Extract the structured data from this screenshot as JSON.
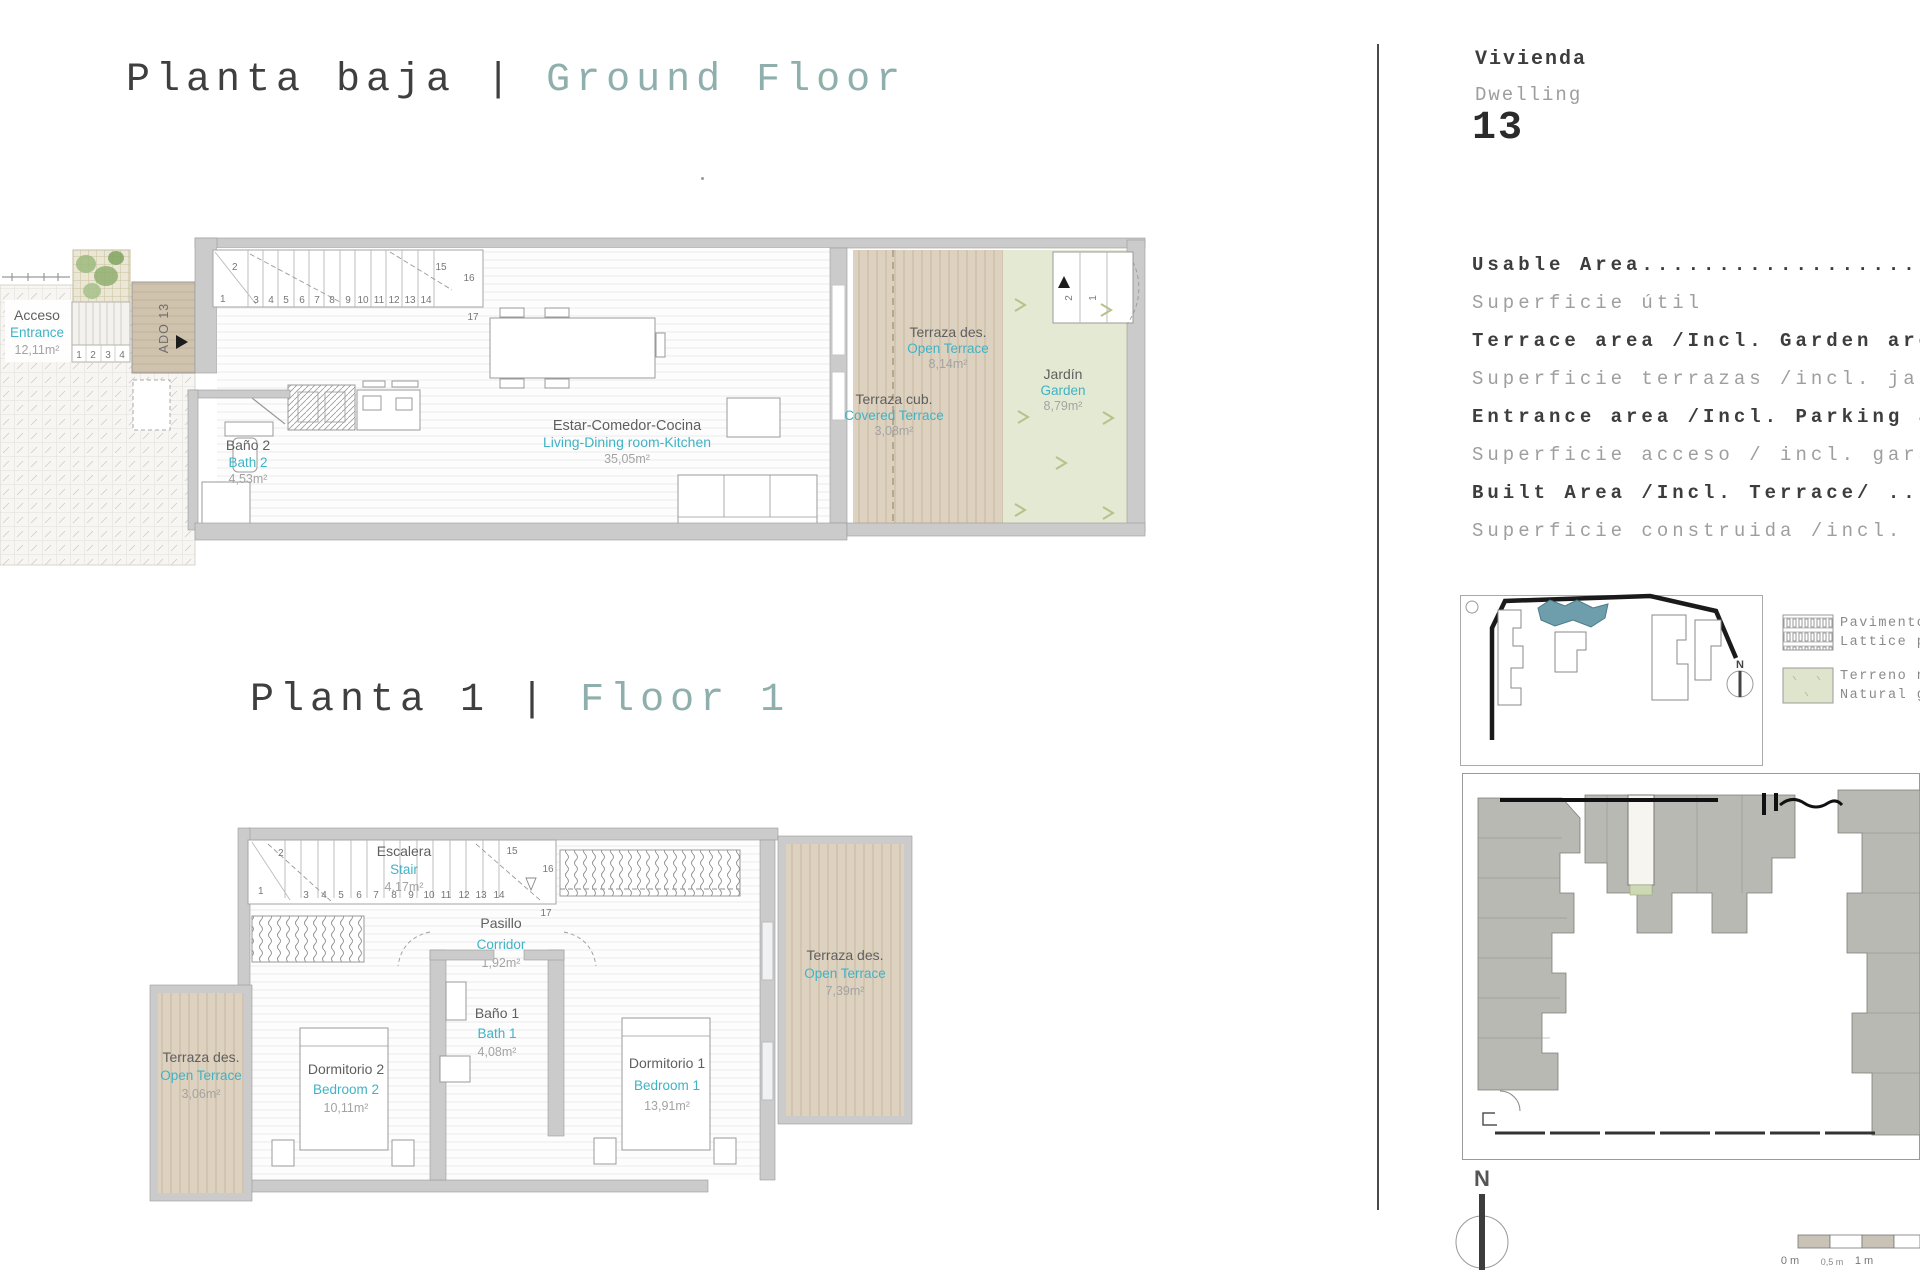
{
  "colors": {
    "accent_teal": "#3fb3c6",
    "title_accent": "#8fafac",
    "tan_terrace": "#ddd1bf",
    "garden_green": "#e4e9d3",
    "site_highlight": "#6e9dab",
    "legend_green": "#dfe5cc"
  },
  "titles": {
    "ground": {
      "es": "Planta baja",
      "sep": "|",
      "en": "Ground Floor"
    },
    "floor1": {
      "es": "Planta 1",
      "sep": "|",
      "en": "Floor 1"
    }
  },
  "right_panel": {
    "vivienda": "Vivienda",
    "dwelling": "Dwelling",
    "number": "13",
    "info_lines": [
      {
        "text": "Usable Area...........................................",
        "style": "bold"
      },
      {
        "text": "Superficie útil",
        "style": "light"
      },
      {
        "text": "Terrace area /Incl. Garden area/ ........",
        "style": "bold"
      },
      {
        "text": "Superficie terrazas /incl. jardín",
        "style": "light"
      },
      {
        "text": "Entrance area /Incl. Parking area/ ......",
        "style": "bold"
      },
      {
        "text": "Superficie acceso / incl. garaje",
        "style": "light"
      },
      {
        "text": "Built Area /Incl. Terrace/ ...............",
        "style": "bold"
      },
      {
        "text": "Superficie construida /incl. terraza",
        "style": "light"
      }
    ],
    "site_compass": "N",
    "legend": [
      {
        "name": "Pavimento",
        "sub": "Lattice pavim."
      },
      {
        "name": "Terreno natural",
        "sub": "Natural ground"
      }
    ],
    "bottom_compass": "N",
    "scale_bar": {
      "labels": [
        "0 m",
        "0,5 m",
        "1 m"
      ]
    }
  },
  "ground_floor": {
    "acceso": {
      "es": "Acceso",
      "en": "Entrance",
      "area": "12,11m²"
    },
    "ado": "ADO 13",
    "entry_steps": [
      "1",
      "2",
      "3",
      "4"
    ],
    "bath2": {
      "es": "Baño 2",
      "en": "Bath 2",
      "area": "4,53m²"
    },
    "living": {
      "es": "Estar-Comedor-Cocina",
      "en": "Living-Dining room-Kitchen",
      "area": "35,05m²"
    },
    "covered_terrace": {
      "es": "Terraza cub.",
      "en": "Covered Terrace",
      "area": "3,08m²"
    },
    "open_terrace": {
      "es": "Terraza des.",
      "en": "Open Terrace",
      "area": "8,14m²"
    },
    "garden": {
      "es": "Jardín",
      "en": "Garden",
      "area": "8,79m²"
    },
    "stair": {
      "n1": "1",
      "n2": "2",
      "row": [
        "3",
        "4",
        "5",
        "6",
        "7",
        "8",
        "9",
        "10",
        "11",
        "12",
        "13",
        "14"
      ],
      "n15": "15",
      "n16": "16",
      "n17": "17"
    },
    "tr_stairs": {
      "a": "2",
      "b": "1"
    }
  },
  "floor1": {
    "stair": {
      "es": "Escalera",
      "en": "Stair",
      "area": "4,17m²",
      "n1": "1",
      "n2": "2",
      "row": [
        "3",
        "4",
        "5",
        "6",
        "7",
        "8",
        "9",
        "10",
        "11",
        "12",
        "13",
        "14"
      ],
      "n15": "15",
      "n16": "16",
      "n17": "17"
    },
    "corridor": {
      "es": "Pasillo",
      "en": "Corridor",
      "area": "1,92m²"
    },
    "bath1": {
      "es": "Baño 1",
      "en": "Bath 1",
      "area": "4,08m²"
    },
    "bedroom2": {
      "es": "Dormitorio 2",
      "en": "Bedroom 2",
      "area": "10,11m²"
    },
    "bedroom1": {
      "es": "Dormitorio 1",
      "en": "Bedroom 1",
      "area": "13,91m²"
    },
    "terrace_left": {
      "es": "Terraza des.",
      "en": "Open Terrace",
      "area": "3,06m²"
    },
    "terrace_right": {
      "es": "Terraza des.",
      "en": "Open Terrace",
      "area": "7,39m²"
    }
  }
}
